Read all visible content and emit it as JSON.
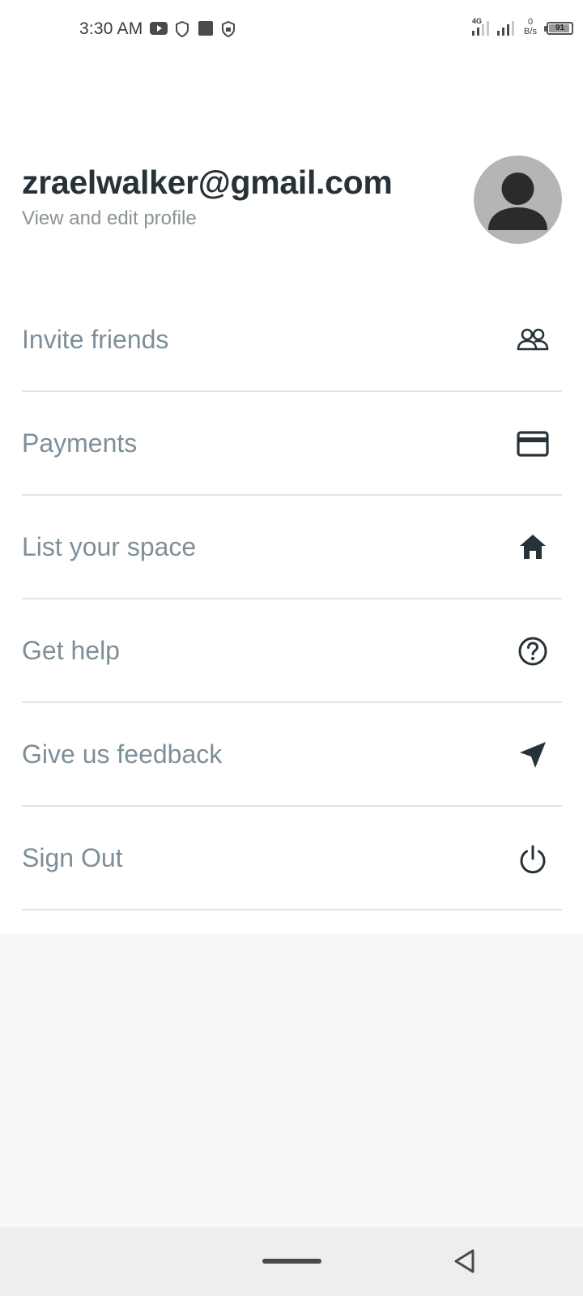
{
  "status_bar": {
    "time": "3:30 AM",
    "network_type": "4G",
    "net_speed_value": "0",
    "net_speed_unit": "B/s",
    "battery_level": "91",
    "icons": [
      "youtube-icon",
      "shield-icon",
      "square-icon",
      "shield-badge-icon",
      "signal-icon",
      "signal-icon",
      "battery-icon"
    ]
  },
  "profile": {
    "email": "zraelwalker@gmail.com",
    "subtitle": "View and edit profile",
    "avatar_icon": "person-icon"
  },
  "menu": {
    "items": [
      {
        "label": "Invite friends",
        "icon": "people-icon"
      },
      {
        "label": "Payments",
        "icon": "credit-card-icon"
      },
      {
        "label": "List your space",
        "icon": "home-icon"
      },
      {
        "label": "Get help",
        "icon": "help-circle-icon"
      },
      {
        "label": "Give us feedback",
        "icon": "send-icon"
      },
      {
        "label": "Sign Out",
        "icon": "power-icon"
      }
    ]
  },
  "nav_bar": {
    "icons": [
      "home-pill-icon",
      "back-icon"
    ]
  },
  "colors": {
    "title_text": "#263238",
    "menu_text": "#7d8f99",
    "subtitle_text": "#8a9296",
    "divider": "#e2e4e5",
    "avatar_bg": "#b5b5b5",
    "icon": "#263238",
    "lower_bg": "#f8f8f8",
    "nav_bg": "#eeeeee"
  }
}
